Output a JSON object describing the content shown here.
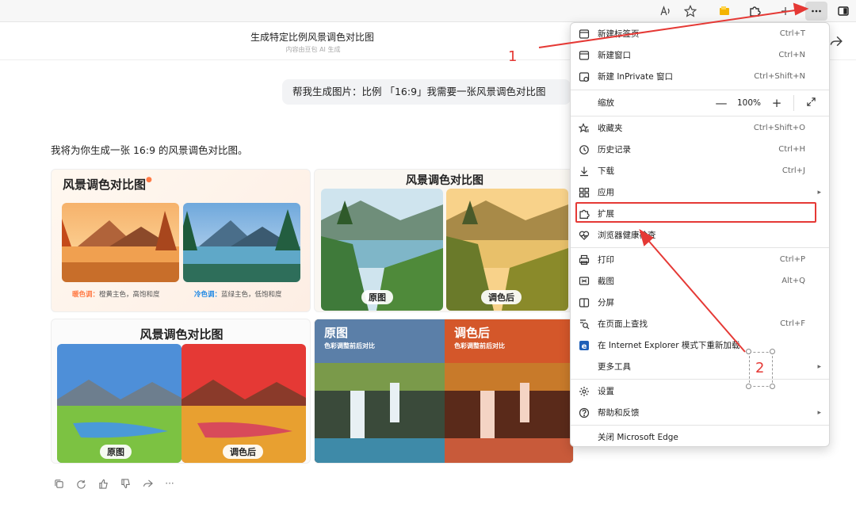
{
  "toolbar": {
    "icons": [
      "read-aloud-icon",
      "favorite-star-icon",
      "collections-icon",
      "extensions-icon",
      "sync-icon",
      "more-icon",
      "sidebar-icon"
    ]
  },
  "chat": {
    "title": "生成特定比例风景调色对比图",
    "subtitle": "内容由豆包 AI 生成",
    "user_message": "帮我生成图片：比例 「16:9」我需要一张风景调色对比图",
    "reply": "我将为你生成一张 16:9 的风景调色对比图。"
  },
  "images": {
    "card1": {
      "title": "风景调色对比图",
      "warm_label": "暖色调：",
      "warm_desc": "橙黄主色，高饱和度",
      "cool_label": "冷色调：",
      "cool_desc": "蓝绿主色，低饱和度"
    },
    "card2": {
      "title": "风景调色对比图",
      "tag_left": "原图",
      "tag_right": "调色后"
    },
    "card3": {
      "title": "风景调色对比图",
      "tag_left": "原图",
      "tag_right": "调色后"
    },
    "card4": {
      "left_title": "原图",
      "left_sub": "色彩调整前后对比",
      "right_title": "调色后",
      "right_sub": "色彩调整前后对比"
    }
  },
  "menu": {
    "items": [
      {
        "label": "新建标签页",
        "shortcut": "Ctrl+T"
      },
      {
        "label": "新建窗口",
        "shortcut": "Ctrl+N"
      },
      {
        "label": "新建 InPrivate 窗口",
        "shortcut": "Ctrl+Shift+N"
      },
      {
        "label": "缩放",
        "shortcut": ""
      },
      {
        "label": "收藏夹",
        "shortcut": "Ctrl+Shift+O"
      },
      {
        "label": "历史记录",
        "shortcut": "Ctrl+H"
      },
      {
        "label": "下载",
        "shortcut": "Ctrl+J"
      },
      {
        "label": "应用",
        "shortcut": ""
      },
      {
        "label": "扩展",
        "shortcut": ""
      },
      {
        "label": "浏览器健康检查",
        "shortcut": ""
      },
      {
        "label": "打印",
        "shortcut": "Ctrl+P"
      },
      {
        "label": "截图",
        "shortcut": "Alt+Q"
      },
      {
        "label": "分屏",
        "shortcut": ""
      },
      {
        "label": "在页面上查找",
        "shortcut": "Ctrl+F"
      },
      {
        "label": "在 Internet Explorer 模式下重新加载",
        "shortcut": ""
      },
      {
        "label": "更多工具",
        "shortcut": ""
      },
      {
        "label": "设置",
        "shortcut": ""
      },
      {
        "label": "帮助和反馈",
        "shortcut": ""
      },
      {
        "label": "关闭 Microsoft Edge",
        "shortcut": ""
      }
    ],
    "zoom": {
      "minus": "—",
      "value": "100%",
      "plus": "+"
    }
  },
  "annotations": {
    "step1": "1",
    "step2": "2"
  },
  "colors": {
    "accent_red": "#e53935",
    "warm": "#ff7a45",
    "cool": "#1e88e5"
  }
}
